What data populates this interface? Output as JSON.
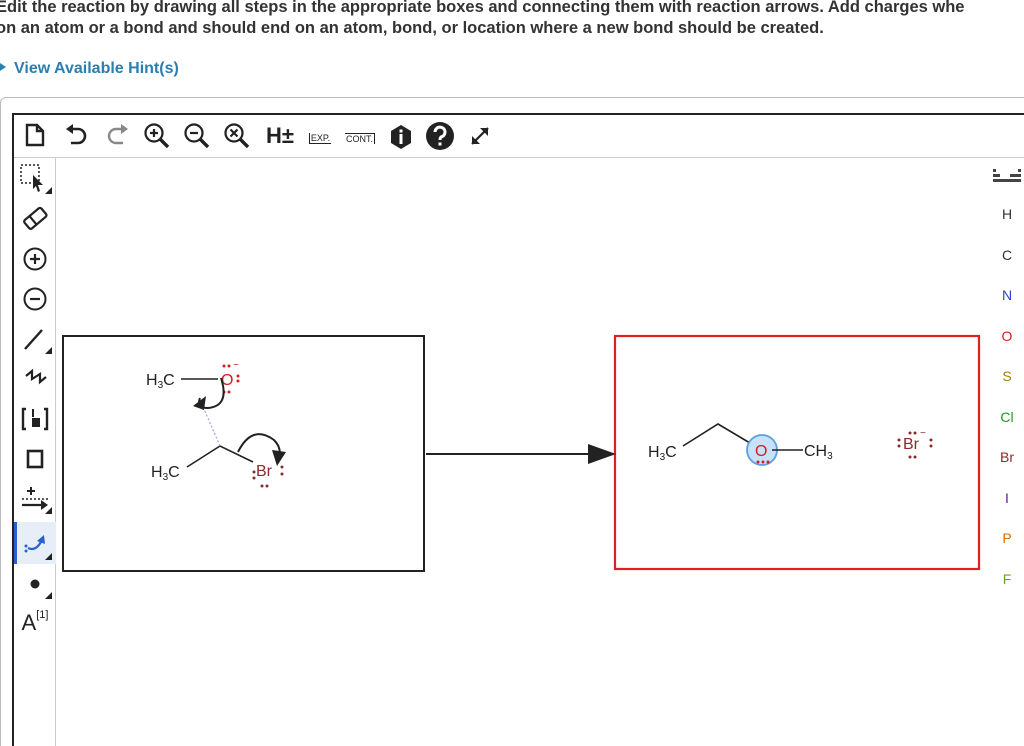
{
  "instructions": {
    "line1": "Edit the reaction by drawing all steps in the appropriate boxes and connecting them with reaction arrows. Add charges whe",
    "line2": "on an atom or a bond and should end on an atom, bond, or location where a new bond should be created."
  },
  "hint": {
    "label": "View Available Hint(s)"
  },
  "toolbar": {
    "h_label": "H±",
    "exp_label": "EXP.",
    "cont_label": "CONT."
  },
  "left_tools": {
    "atom_map_label": "A",
    "atom_map_index": "[1]"
  },
  "elements": [
    "H",
    "C",
    "N",
    "O",
    "S",
    "Cl",
    "Br",
    "I",
    "P",
    "F"
  ],
  "element_colors": {
    "H": "#333333",
    "C": "#333333",
    "N": "#2a3fd0",
    "O": "#d02020",
    "S": "#a08000",
    "Cl": "#1a9a1a",
    "Br": "#8a2a2a",
    "I": "#6a1a8a",
    "P": "#d07000",
    "F": "#70a020"
  },
  "reactant_box": {
    "methoxide_carbon": "H",
    "methoxide_carbon_sub": "3",
    "methoxide_carbon_tail": "C",
    "methoxide_oxygen": "O",
    "methoxide_charge": "−",
    "ethyl_carbon": "H",
    "ethyl_carbon_sub": "3",
    "ethyl_carbon_tail": "C",
    "bromine": "Br"
  },
  "product_box": {
    "ether_carbon": "H",
    "ether_carbon_sub": "3",
    "ether_carbon_tail": "C",
    "ether_oxygen": "O",
    "methyl": "CH",
    "methyl_sub": "3",
    "bromide": "Br",
    "bromide_charge": "−"
  },
  "colors": {
    "accent": "#2a7fb0",
    "product_border": "#e02020",
    "highlight": "#5aa0e0"
  }
}
